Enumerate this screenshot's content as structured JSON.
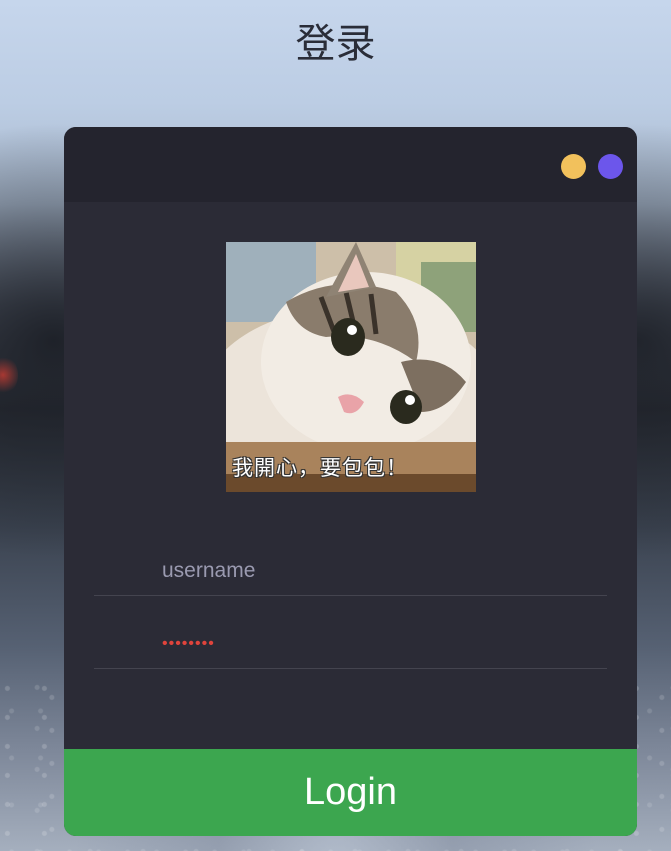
{
  "page": {
    "title": "登录"
  },
  "window_controls": {
    "yellow_color": "#f2c15c",
    "purple_color": "#6c56eb"
  },
  "avatar": {
    "caption": "我開心，要包包！"
  },
  "form": {
    "username_placeholder": "username",
    "username_value": "",
    "password_value": "••••••••"
  },
  "login_button": {
    "label": "Login",
    "color": "#3ca64f"
  }
}
